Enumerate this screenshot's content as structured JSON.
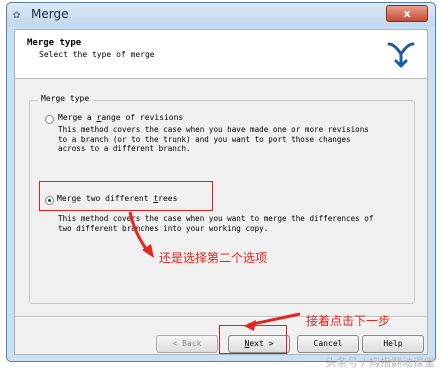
{
  "window": {
    "title": "Merge",
    "close_label": "x"
  },
  "header": {
    "title": "Merge type",
    "subtitle": "Select the type of merge",
    "logo_icon": "tortoise-merge-icon"
  },
  "group": {
    "legend": "Merge type",
    "options": [
      {
        "label_pre": "Merge a ",
        "label_key": "r",
        "label_post": "ange of revisions",
        "selected": false,
        "description": "This method covers the case when you have made one or more revisions\nto a branch (or to the trunk) and you want to port those changes\nacross to a different branch."
      },
      {
        "label_pre": "Merge two different ",
        "label_key": "t",
        "label_post": "rees",
        "selected": true,
        "description": "This method covers the case when you want to merge the differences of\ntwo different branches into your working copy."
      }
    ]
  },
  "annotations": {
    "note1": "还是选择第二个选项",
    "note2": "接着点击下一步",
    "accent": "#e52521"
  },
  "buttons": {
    "back": "< Back",
    "next": "Next >",
    "cancel": "Cancel",
    "help": "Help"
  },
  "watermark": "头条号 / 拇指翻动课堂"
}
